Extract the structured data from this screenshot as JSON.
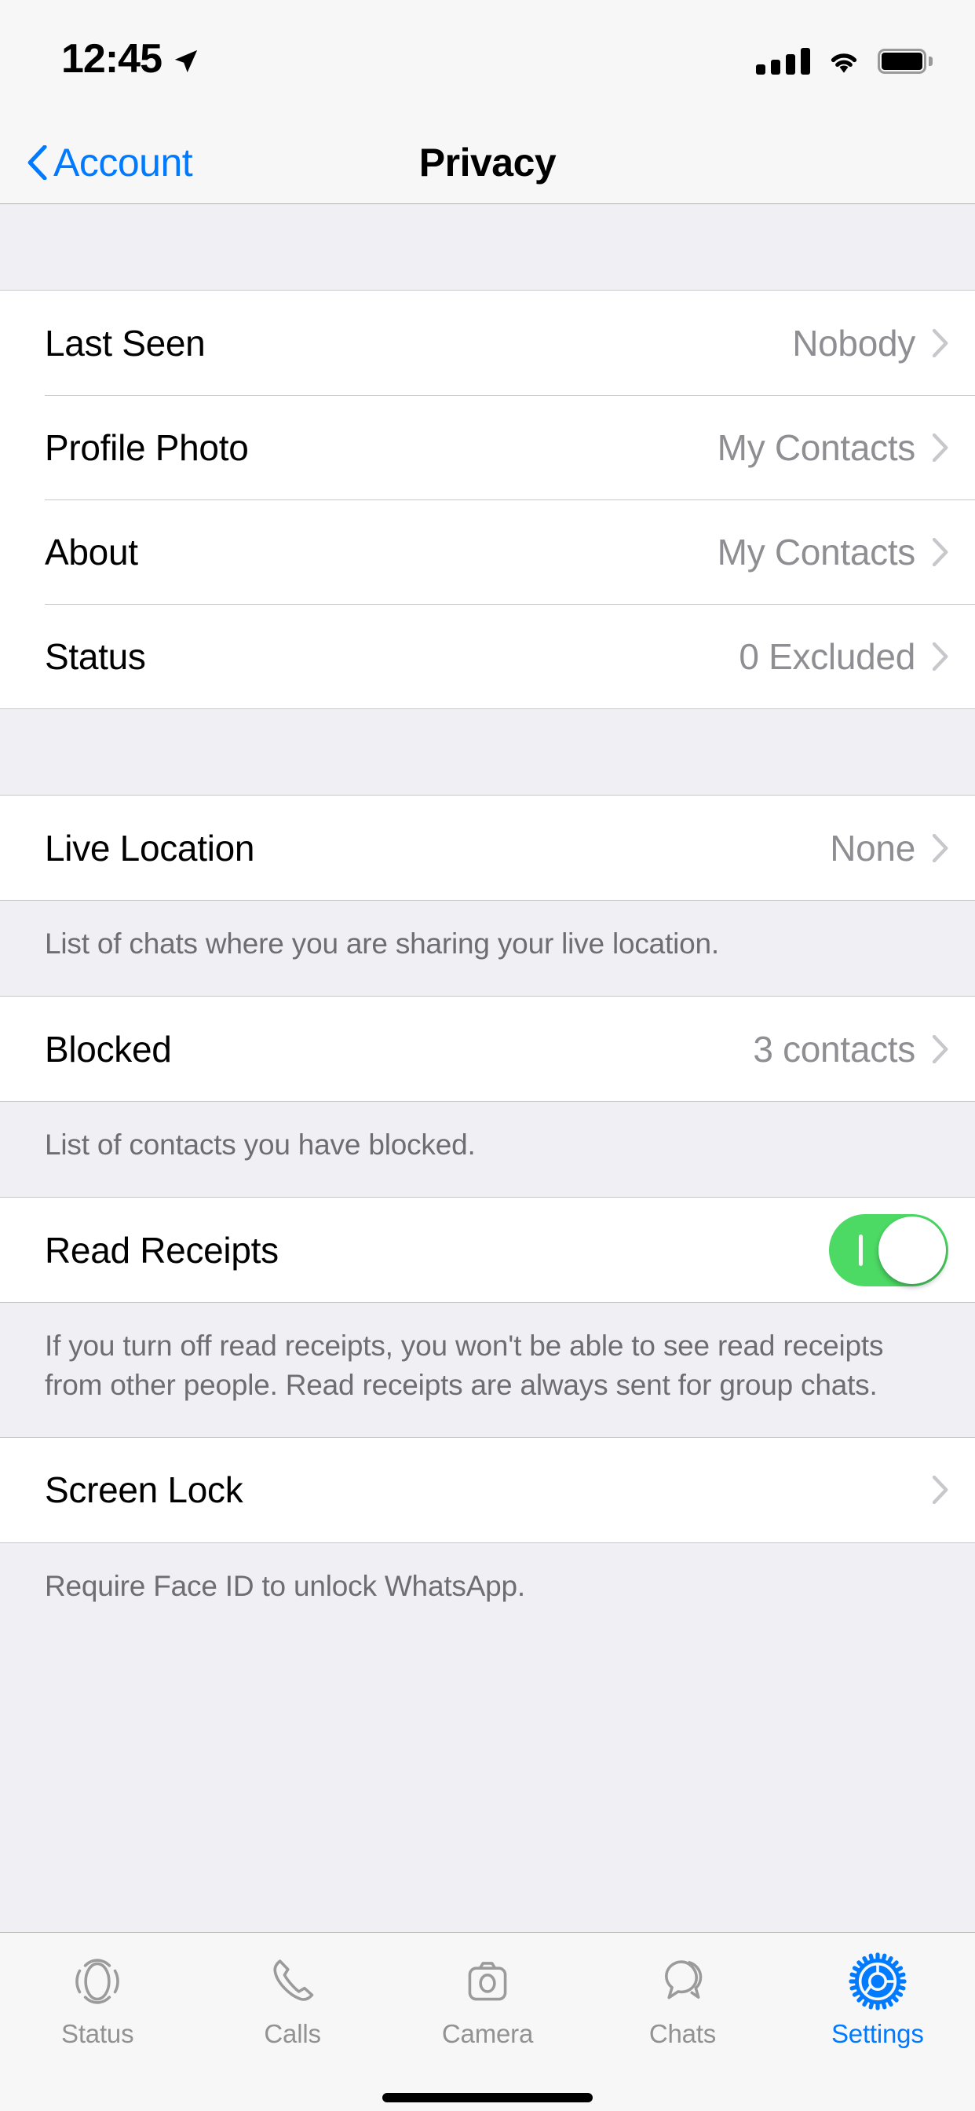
{
  "status_bar": {
    "time": "12:45",
    "location_icon": "location-arrow-icon",
    "signal_icon": "cellular-signal-icon",
    "wifi_icon": "wifi-icon",
    "battery_icon": "battery-full-icon"
  },
  "nav": {
    "back_label": "Account",
    "back_icon": "chevron-left-icon",
    "title": "Privacy"
  },
  "sections": [
    {
      "rows": [
        {
          "label": "Last Seen",
          "value": "Nobody",
          "accessory": "chevron"
        },
        {
          "label": "Profile Photo",
          "value": "My Contacts",
          "accessory": "chevron"
        },
        {
          "label": "About",
          "value": "My Contacts",
          "accessory": "chevron"
        },
        {
          "label": "Status",
          "value": "0 Excluded",
          "accessory": "chevron"
        }
      ],
      "footer": ""
    },
    {
      "rows": [
        {
          "label": "Live Location",
          "value": "None",
          "accessory": "chevron"
        }
      ],
      "footer": "List of chats where you are sharing your live location."
    },
    {
      "rows": [
        {
          "label": "Blocked",
          "value": "3 contacts",
          "accessory": "chevron"
        }
      ],
      "footer": "List of contacts you have blocked."
    },
    {
      "rows": [
        {
          "label": "Read Receipts",
          "value": "",
          "accessory": "switch",
          "switch_on": true
        }
      ],
      "footer": "If you turn off read receipts, you won't be able to see read receipts from other people. Read receipts are always sent for group chats."
    },
    {
      "rows": [
        {
          "label": "Screen Lock",
          "value": "",
          "accessory": "chevron"
        }
      ],
      "footer": "Require Face ID to unlock WhatsApp."
    }
  ],
  "tabbar": {
    "items": [
      {
        "label": "Status",
        "icon": "status-rings-icon",
        "active": false
      },
      {
        "label": "Calls",
        "icon": "phone-icon",
        "active": false
      },
      {
        "label": "Camera",
        "icon": "camera-icon",
        "active": false
      },
      {
        "label": "Chats",
        "icon": "chat-bubbles-icon",
        "active": false
      },
      {
        "label": "Settings",
        "icon": "gear-icon",
        "active": true
      }
    ]
  },
  "colors": {
    "accent": "#007AFF",
    "toggle_on": "#4CD964",
    "value_text": "#8E8E93",
    "footer_text": "#6D6D72",
    "group_bg": "#FFFFFF",
    "page_bg": "#EFEFF4",
    "bar_bg": "#F7F7F7",
    "separator": "#C8C7CC"
  }
}
